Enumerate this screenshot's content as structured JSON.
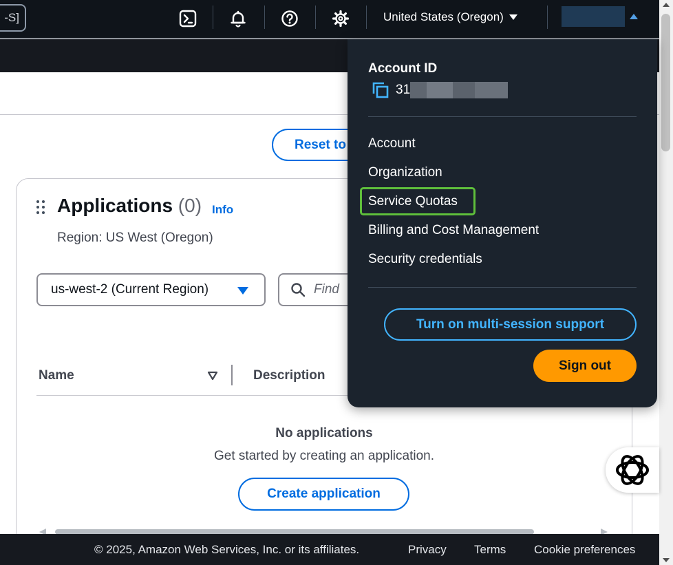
{
  "topnav": {
    "shortcut_text": "-S]",
    "icons": [
      "cloudshell-icon",
      "bell-icon",
      "help-icon",
      "gear-icon"
    ],
    "region_label": "United States (Oregon)"
  },
  "toolbar": {
    "reset_label": "Reset to"
  },
  "panel": {
    "title": "Applications",
    "count": "(0)",
    "info_label": "Info",
    "subtitle": "Region: US West (Oregon)",
    "region_select_value": "us-west-2 (Current Region)",
    "search_placeholder": "Find",
    "columns": [
      "Name",
      "Description"
    ],
    "empty_title": "No applications",
    "empty_subtitle": "Get started by creating an application.",
    "create_label": "Create application"
  },
  "account_menu": {
    "account_id_label": "Account ID",
    "account_id_prefix": "31",
    "items": [
      "Account",
      "Organization",
      "Service Quotas",
      "Billing and Cost Management",
      "Security credentials"
    ],
    "highlighted_item": "Service Quotas",
    "multi_session_label": "Turn on multi-session support",
    "sign_out_label": "Sign out"
  },
  "footer": {
    "copyright": "© 2025, Amazon Web Services, Inc. or its affiliates.",
    "links": [
      "Privacy",
      "Terms",
      "Cookie preferences"
    ]
  },
  "colors": {
    "nav_bg": "#0f141a",
    "dropdown_bg": "#1b232d",
    "link_blue": "#006ce0",
    "accent_orange": "#ff9900",
    "highlight_green": "#5fbf3b",
    "cyan_button": "#42b4ff"
  }
}
